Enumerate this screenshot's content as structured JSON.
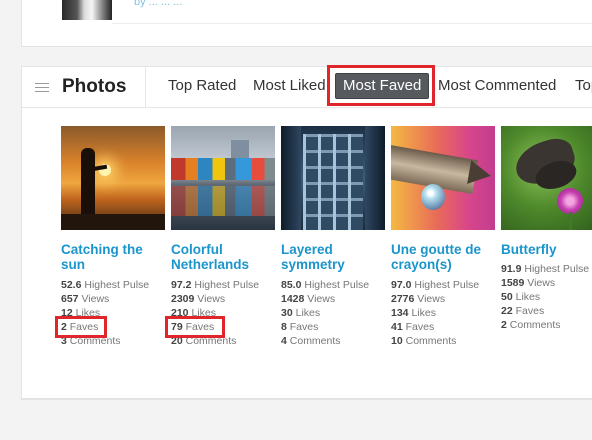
{
  "top": {
    "link_text": "by  ...  ...  ..."
  },
  "panel": {
    "title": "Photos",
    "tabs": [
      {
        "label": "Top Rated"
      },
      {
        "label": "Most Liked"
      },
      {
        "label": "Most Faved"
      },
      {
        "label": "Most Commented"
      },
      {
        "label": "Top"
      }
    ],
    "active_tab": "Most Faved"
  },
  "photos": [
    {
      "title": "Catching the sun",
      "pulse_value": "52.6",
      "pulse_label": "Highest Pulse",
      "views_value": "657",
      "views_label": "Views",
      "likes_value": "12",
      "likes_label": "Likes",
      "faves_value": "2",
      "faves_label": "Faves",
      "comments_value": "3",
      "comments_label": "Comments"
    },
    {
      "title": "Colorful Netherlands",
      "pulse_value": "97.2",
      "pulse_label": "Highest Pulse",
      "views_value": "2309",
      "views_label": "Views",
      "likes_value": "210",
      "likes_label": "Likes",
      "faves_value": "79",
      "faves_label": "Faves",
      "comments_value": "20",
      "comments_label": "Comments"
    },
    {
      "title": "Layered symmetry",
      "pulse_value": "85.0",
      "pulse_label": "Highest Pulse",
      "views_value": "1428",
      "views_label": "Views",
      "likes_value": "30",
      "likes_label": "Likes",
      "faves_value": "8",
      "faves_label": "Faves",
      "comments_value": "4",
      "comments_label": "Comments"
    },
    {
      "title": "Une goutte de crayon(s)",
      "pulse_value": "97.0",
      "pulse_label": "Highest Pulse",
      "views_value": "2776",
      "views_label": "Views",
      "likes_value": "134",
      "likes_label": "Likes",
      "faves_value": "41",
      "faves_label": "Faves",
      "comments_value": "10",
      "comments_label": "Comments"
    },
    {
      "title": "Butterfly",
      "pulse_value": "91.9",
      "pulse_label": "Highest Pulse",
      "views_value": "1589",
      "views_label": "Views",
      "likes_value": "50",
      "likes_label": "Likes",
      "faves_value": "22",
      "faves_label": "Faves",
      "comments_value": "2",
      "comments_label": "Comments"
    }
  ],
  "colors": {
    "accent_link": "#1b95cc",
    "active_tab_bg": "#565a5e",
    "highlight_red": "#e0262b"
  }
}
